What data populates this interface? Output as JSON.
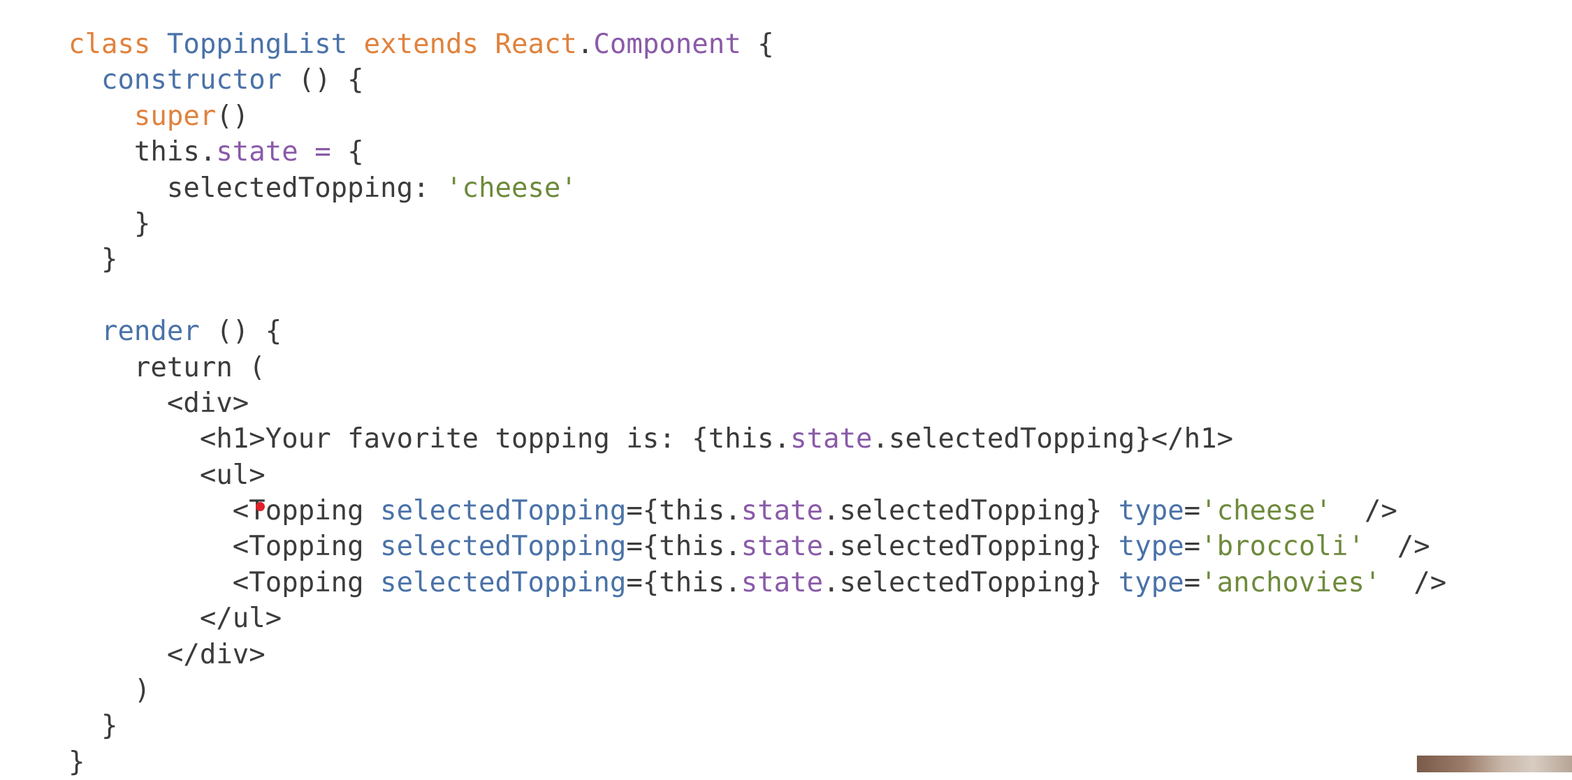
{
  "editor": {
    "lines": [
      [
        {
          "t": "class ",
          "c": "keyword"
        },
        {
          "t": "ToppingList",
          "c": "class"
        },
        {
          "t": " extends ",
          "c": "keyword"
        },
        {
          "t": "React",
          "c": "keyword"
        },
        {
          "t": ".",
          "c": "default"
        },
        {
          "t": "Component",
          "c": "prop"
        },
        {
          "t": " {",
          "c": "default"
        }
      ],
      [
        {
          "t": "  constructor",
          "c": "class"
        },
        {
          "t": " () {",
          "c": "default"
        }
      ],
      [
        {
          "t": "    super",
          "c": "keyword"
        },
        {
          "t": "()",
          "c": "default"
        }
      ],
      [
        {
          "t": "    this.",
          "c": "default"
        },
        {
          "t": "state",
          "c": "prop"
        },
        {
          "t": " = ",
          "c": "prop"
        },
        {
          "t": "{",
          "c": "default"
        }
      ],
      [
        {
          "t": "      selectedTopping: ",
          "c": "default"
        },
        {
          "t": "'cheese'",
          "c": "string"
        }
      ],
      [
        {
          "t": "    }",
          "c": "default"
        }
      ],
      [
        {
          "t": "  }",
          "c": "default"
        }
      ],
      [
        {
          "t": "",
          "c": "default"
        }
      ],
      [
        {
          "t": "  render",
          "c": "class"
        },
        {
          "t": " () {",
          "c": "default"
        }
      ],
      [
        {
          "t": "    return (",
          "c": "default"
        }
      ],
      [
        {
          "t": "      <div>",
          "c": "default"
        }
      ],
      [
        {
          "t": "        <h1>Your favorite topping is: {this.",
          "c": "default"
        },
        {
          "t": "state",
          "c": "prop"
        },
        {
          "t": ".selectedTopping}</h1>",
          "c": "default"
        }
      ],
      [
        {
          "t": "        <ul>",
          "c": "default"
        }
      ],
      [
        {
          "t": "          <Topping ",
          "c": "default"
        },
        {
          "t": "selectedTopping",
          "c": "attr"
        },
        {
          "t": "={this.",
          "c": "default"
        },
        {
          "t": "state",
          "c": "prop"
        },
        {
          "t": ".selectedTopping} ",
          "c": "default"
        },
        {
          "t": "type",
          "c": "attr"
        },
        {
          "t": "=",
          "c": "default"
        },
        {
          "t": "'cheese'",
          "c": "string"
        },
        {
          "t": "  />",
          "c": "default"
        }
      ],
      [
        {
          "t": "          <Topping ",
          "c": "default"
        },
        {
          "t": "selectedTopping",
          "c": "attr"
        },
        {
          "t": "={this.",
          "c": "default"
        },
        {
          "t": "state",
          "c": "prop"
        },
        {
          "t": ".selectedTopping} ",
          "c": "default"
        },
        {
          "t": "type",
          "c": "attr"
        },
        {
          "t": "=",
          "c": "default"
        },
        {
          "t": "'broccoli'",
          "c": "string"
        },
        {
          "t": "  />",
          "c": "default"
        }
      ],
      [
        {
          "t": "          <Topping ",
          "c": "default"
        },
        {
          "t": "selectedTopping",
          "c": "attr"
        },
        {
          "t": "={this.",
          "c": "default"
        },
        {
          "t": "state",
          "c": "prop"
        },
        {
          "t": ".selectedTopping} ",
          "c": "default"
        },
        {
          "t": "type",
          "c": "attr"
        },
        {
          "t": "=",
          "c": "default"
        },
        {
          "t": "'anchovies'",
          "c": "string"
        },
        {
          "t": "  />",
          "c": "default"
        }
      ],
      [
        {
          "t": "        </ul>",
          "c": "default"
        }
      ],
      [
        {
          "t": "      </div>",
          "c": "default"
        }
      ],
      [
        {
          "t": "    )",
          "c": "default"
        }
      ],
      [
        {
          "t": "  }",
          "c": "default"
        }
      ],
      [
        {
          "t": "}",
          "c": "default"
        }
      ]
    ]
  }
}
